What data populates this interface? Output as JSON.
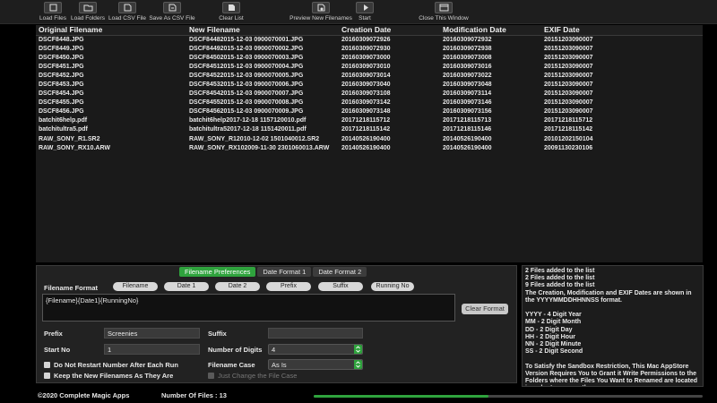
{
  "toolbar": {
    "buttons": [
      {
        "label": "Load Files",
        "icon": "load-files-icon"
      },
      {
        "label": "Load Folders",
        "icon": "load-folders-icon"
      },
      {
        "label": "Load CSV File",
        "icon": "load-csv-icon"
      },
      {
        "label": "Save As CSV File",
        "icon": "save-csv-icon"
      },
      {
        "label": "Clear List",
        "icon": "clear-list-icon"
      },
      {
        "label": "Preview New Filenames",
        "icon": "preview-icon"
      },
      {
        "label": "Start",
        "icon": "start-icon"
      },
      {
        "label": "Close This Window",
        "icon": "close-window-icon"
      }
    ]
  },
  "table": {
    "columns": [
      "Original Filename",
      "New Filename",
      "Creation Date",
      "Modification Date",
      "EXIF Date"
    ],
    "rows": [
      [
        "DSCF8448.JPG",
        "DSCF84482015-12-03 0900070001.JPG",
        "20160309072926",
        "20160309072932",
        "20151203090007"
      ],
      [
        "DSCF8449.JPG",
        "DSCF84492015-12-03 0900070002.JPG",
        "20160309072930",
        "20160309072938",
        "20151203090007"
      ],
      [
        "DSCF8450.JPG",
        "DSCF84502015-12-03 0900070003.JPG",
        "20160309073000",
        "20160309073008",
        "20151203090007"
      ],
      [
        "DSCF8451.JPG",
        "DSCF84512015-12-03 0900070004.JPG",
        "20160309073010",
        "20160309073016",
        "20151203090007"
      ],
      [
        "DSCF8452.JPG",
        "DSCF84522015-12-03 0900070005.JPG",
        "20160309073014",
        "20160309073022",
        "20151203090007"
      ],
      [
        "DSCF8453.JPG",
        "DSCF84532015-12-03 0900070006.JPG",
        "20160309073040",
        "20160309073048",
        "20151203090007"
      ],
      [
        "DSCF8454.JPG",
        "DSCF84542015-12-03 0900070007.JPG",
        "20160309073108",
        "20160309073114",
        "20151203090007"
      ],
      [
        "DSCF8455.JPG",
        "DSCF84552015-12-03 0900070008.JPG",
        "20160309073142",
        "20160309073146",
        "20151203090007"
      ],
      [
        "DSCF8456.JPG",
        "DSCF84562015-12-03 0900070009.JPG",
        "20160309073148",
        "20160309073156",
        "20151203090007"
      ],
      [
        "batchit6help.pdf",
        "batchit6help2017-12-18 1157120010.pdf",
        "20171218115712",
        "20171218115713",
        "20171218115712"
      ],
      [
        "batchitultra5.pdf",
        "batchitultra52017-12-18 1151420011.pdf",
        "20171218115142",
        "20171218115146",
        "20171218115142"
      ],
      [
        "RAW_SONY_R1.SR2",
        "RAW_SONY_R12010-12-02 1501040012.SR2",
        "20140526190400",
        "20140526190400",
        "20101202150104"
      ],
      [
        "RAW_SONY_RX10.ARW",
        "RAW_SONY_RX102009-11-30 2301060013.ARW",
        "20140526190400",
        "20140526190400",
        "20091130230106"
      ]
    ]
  },
  "panel": {
    "tabs": [
      "Filename Preferences",
      "Date Format 1",
      "Date Format 2"
    ],
    "filename_format_label": "Filename Format",
    "tokens": [
      "Filename",
      "Date 1",
      "Date 2",
      "Prefix",
      "Suffix",
      "Running No"
    ],
    "format_value": "{Filename}{Date1}{RunningNo}",
    "clear_format_label": "Clear Format",
    "prefix_label": "Prefix",
    "prefix_value": "Screenies",
    "suffix_label": "Suffix",
    "suffix_value": "",
    "start_no_label": "Start No",
    "start_no_value": "1",
    "digits_label": "Number of Digits",
    "digits_value": "4",
    "case_label": "Filename Case",
    "case_value": "As Is",
    "chk_restart": "Do Not Restart Number After Each Run",
    "chk_keep": "Keep the New Filenames As They Are",
    "chk_change_case": "Just Change the File Case"
  },
  "log": {
    "lines": [
      "2 Files added to the list",
      "2 Files added to the list",
      "9 Files added to the list",
      "The Creation, Modification and EXIF Dates are shown in the YYYYMMDDHHNNSS format.",
      "",
      "YYYY - 4 Digit Year",
      "MM - 2 Digit Month",
      "DD - 2 Digit Day",
      "HH - 2 Digit Hour",
      "NN - 2 Digit Minute",
      "SS - 2 Digit Second",
      "",
      "To Satisfy the Sandbox Restriction, This Mac AppStore Version Requires You to Grant it Write Permissions to the Folders where the Files You Want to Renamed are located in order to rename them."
    ]
  },
  "status": {
    "copyright": "©2020 Complete Magic Apps",
    "file_count": "Number Of Files : 13",
    "progress": 0.45
  },
  "colors": {
    "accent": "#2fa33d",
    "background": "#000000"
  }
}
